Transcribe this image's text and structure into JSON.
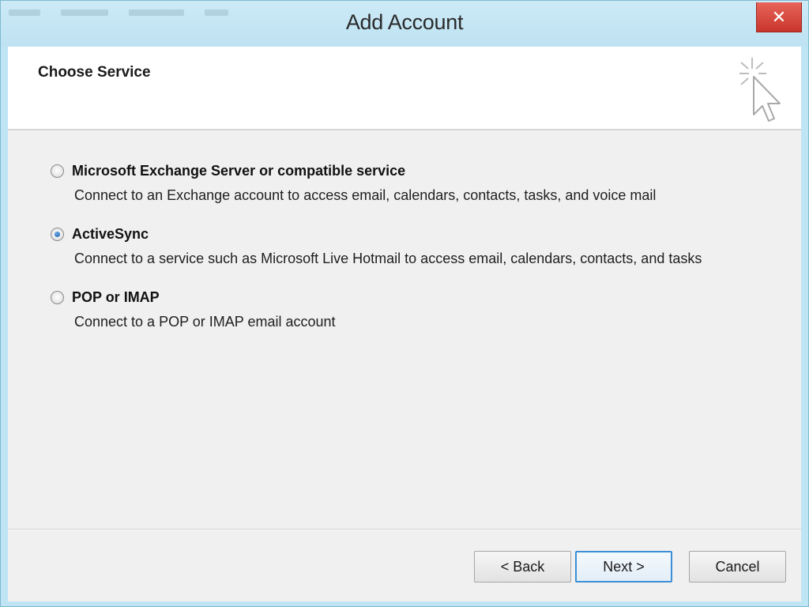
{
  "window": {
    "title": "Add Account",
    "close_glyph": "✕"
  },
  "header": {
    "title": "Choose Service",
    "art_icon": "cursor-sparkle-icon"
  },
  "options": [
    {
      "label": "Microsoft Exchange Server or compatible service",
      "description": "Connect to an Exchange account to access email, calendars, contacts, tasks, and voice mail",
      "selected": false
    },
    {
      "label": "ActiveSync",
      "description": "Connect to a service such as Microsoft Live Hotmail to access email, calendars, contacts, and tasks",
      "selected": true
    },
    {
      "label": "POP or IMAP",
      "description": "Connect to a POP or IMAP email account",
      "selected": false
    }
  ],
  "buttons": {
    "back": "< Back",
    "next": "Next >",
    "cancel": "Cancel"
  },
  "colors": {
    "titlebar": "#bfe4f3",
    "close": "#d4453b",
    "accent": "#3c8fd6"
  }
}
